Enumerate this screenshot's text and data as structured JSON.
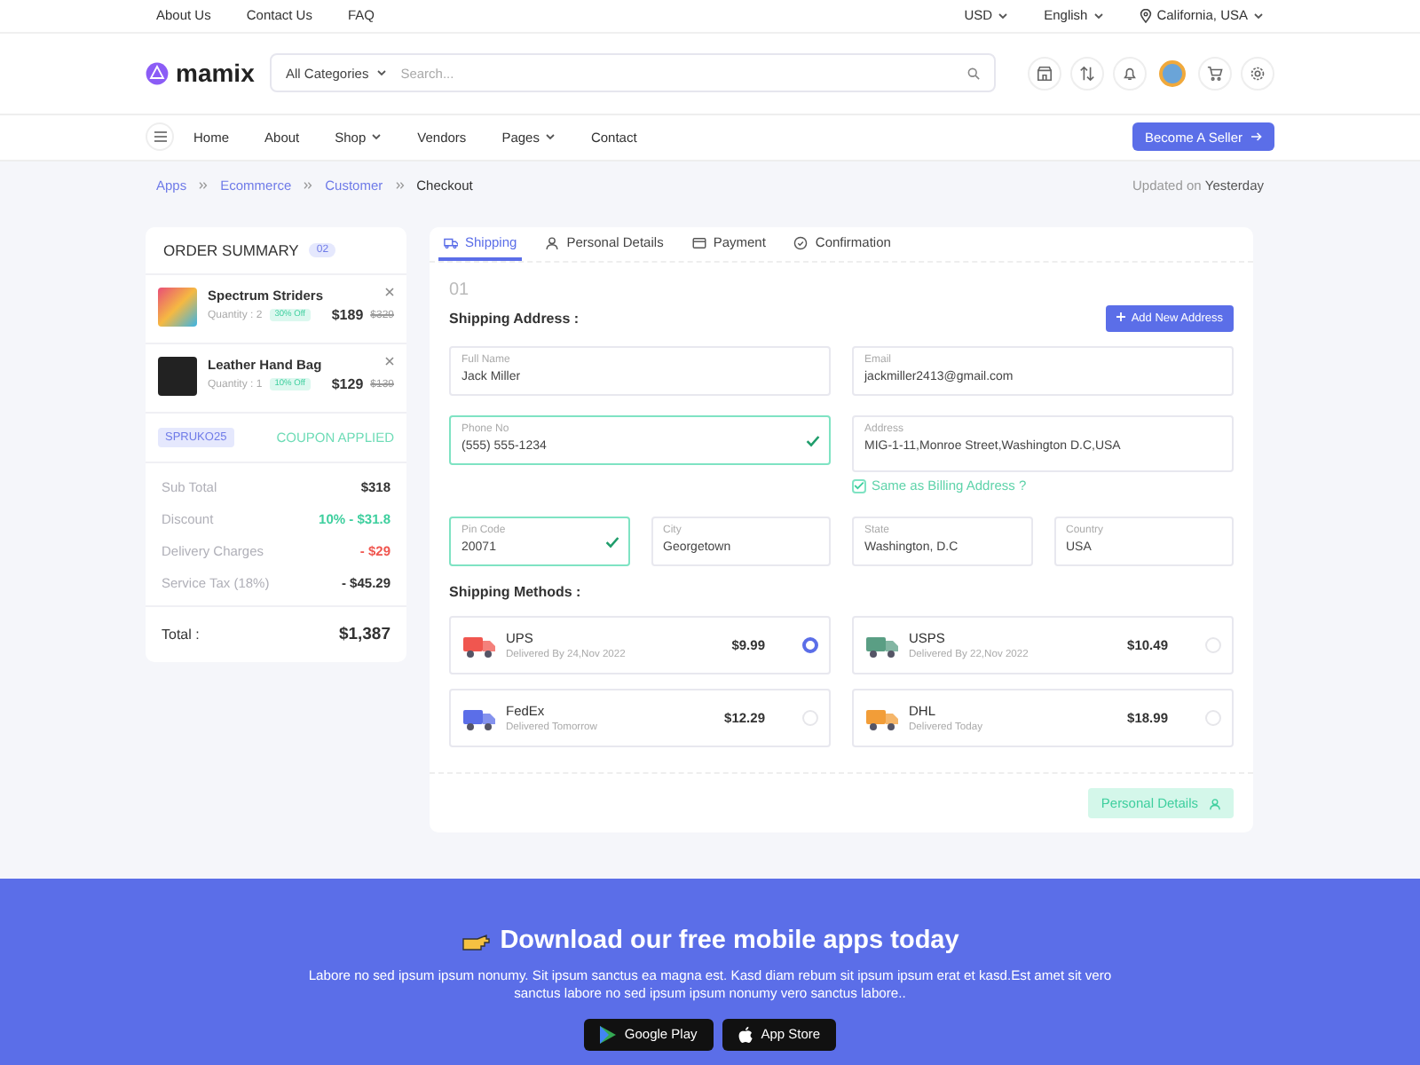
{
  "top_links": [
    "About Us",
    "Contact Us",
    "FAQ"
  ],
  "top_selects": [
    {
      "label": "USD",
      "kind": "dropdown"
    },
    {
      "label": "English",
      "kind": "dropdown"
    },
    {
      "label": "California, USA",
      "kind": "location"
    }
  ],
  "header": {
    "logo": "mamix",
    "category": "All Categories",
    "search_placeholder": "Search..."
  },
  "nav": {
    "items": [
      {
        "label": "Home",
        "dropdown": false
      },
      {
        "label": "About",
        "dropdown": false
      },
      {
        "label": "Shop",
        "dropdown": true
      },
      {
        "label": "Vendors",
        "dropdown": false
      },
      {
        "label": "Pages",
        "dropdown": true
      },
      {
        "label": "Contact",
        "dropdown": false
      }
    ],
    "button": "Become A Seller"
  },
  "breadcrumb": {
    "items": [
      "Apps",
      "Ecommerce",
      "Customer",
      "Checkout"
    ],
    "updated_label": "Updated on",
    "updated_value": "Yesterday"
  },
  "order_summary": {
    "title": "ORDER SUMMARY",
    "count": "02",
    "products": [
      {
        "name": "Spectrum Striders",
        "quantity": "Quantity : 2",
        "discount": "30% Off",
        "price": "$189",
        "old_price": "$329",
        "kind": "shoe"
      },
      {
        "name": "Leather Hand Bag",
        "quantity": "Quantity : 1",
        "discount": "10% Off",
        "price": "$129",
        "old_price": "$139",
        "kind": "bag"
      }
    ],
    "coupon": "SPRUKO25",
    "coupon_status": "COUPON APPLIED",
    "lines": [
      {
        "label": "Sub Total",
        "value": "$318",
        "kind": "normal"
      },
      {
        "label": "Discount",
        "value": "10% - $31.8",
        "kind": "discount"
      },
      {
        "label": "Delivery Charges",
        "value": "- $29",
        "kind": "charge"
      },
      {
        "label": "Service Tax (18%)",
        "value": "- $45.29",
        "kind": "normal"
      }
    ],
    "total_label": "Total :",
    "total": "$1,387"
  },
  "checkout": {
    "tabs": [
      {
        "label": "Shipping",
        "kind": "truck",
        "selected": true
      },
      {
        "label": "Personal Details",
        "kind": "user",
        "selected": false
      },
      {
        "label": "Payment",
        "kind": "card",
        "selected": false
      },
      {
        "label": "Confirmation",
        "kind": "check",
        "selected": false
      }
    ],
    "step": "01",
    "section_title": "Shipping Address :",
    "add_button": "Add New Address",
    "field_rows": [
      [
        {
          "label": "Full Name",
          "value": "Jack Miller",
          "kind": "text",
          "valid": false
        },
        {
          "label": "Email",
          "value": "jackmiller2413@gmail.com",
          "kind": "text",
          "valid": false
        }
      ],
      [
        {
          "label": "Phone No",
          "value": "(555) 555-1234",
          "kind": "text",
          "valid": true
        },
        {
          "label": "Address",
          "value": "MIG-1-11,Monroe Street,Washington D.C,USA",
          "kind": "textarea",
          "valid": false
        }
      ],
      [
        {
          "label": "Pin Code",
          "value": "20071",
          "kind": "text",
          "valid": true
        },
        {
          "label": "City",
          "value": "Georgetown",
          "kind": "text",
          "valid": false
        },
        {
          "label": "State",
          "value": "Washington, D.C",
          "kind": "text",
          "valid": false
        },
        {
          "label": "Country",
          "value": "USA",
          "kind": "text",
          "valid": false
        }
      ]
    ],
    "billing_same": {
      "label": "Same as Billing Address ?",
      "checked": true
    },
    "methods_title": "Shipping Methods :",
    "methods": [
      {
        "name": "UPS",
        "delivery": "Delivered By 24,Nov 2022",
        "price": "$9.99",
        "color": "#f0564f",
        "selected": true
      },
      {
        "name": "USPS",
        "delivery": "Delivered By 22,Nov 2022",
        "price": "$10.49",
        "color": "#5a9e84",
        "selected": false
      },
      {
        "name": "FedEx",
        "delivery": "Delivered Tomorrow",
        "price": "$12.29",
        "color": "#5b6ee8",
        "selected": false
      },
      {
        "name": "DHL",
        "delivery": "Delivered Today",
        "price": "$18.99",
        "color": "#f29d38",
        "selected": false
      }
    ],
    "next_button": "Personal Details"
  },
  "banner": {
    "title": "Download our free mobile apps today",
    "text": "Labore no sed ipsum ipsum nonumy. Sit ipsum sanctus ea magna est. Kasd diam rebum sit ipsum ipsum erat et kasd.Est amet sit vero sanctus labore no sed ipsum ipsum nonumy vero sanctus labore..",
    "stores": [
      {
        "label": "Google Play",
        "kind": "play"
      },
      {
        "label": "App Store",
        "kind": "apple"
      }
    ]
  }
}
